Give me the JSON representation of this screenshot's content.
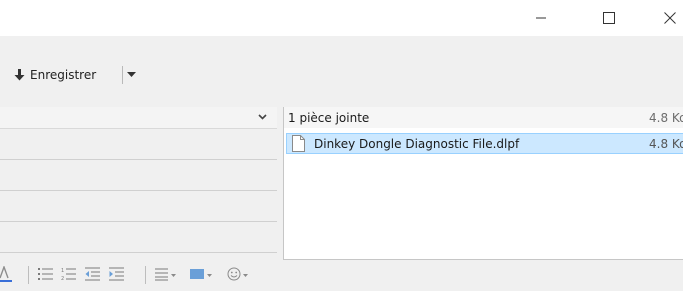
{
  "window_controls": {
    "minimize_icon": "minimize-icon",
    "maximize_icon": "maximize-icon",
    "close_icon": "close-icon"
  },
  "toolbar": {
    "save_label": "Enregistrer",
    "save_icon": "download-arrow-icon",
    "dropdown_icon": "caret-down-icon"
  },
  "attachments": {
    "header_label": "1 pièce jointe",
    "header_size": "4.8 Ko",
    "items": [
      {
        "name": "Dinkey Dongle Diagnostic File.dlpf",
        "size": "4.8 Ko"
      }
    ]
  },
  "colors": {
    "selection_fill": "#cce8ff",
    "selection_border": "#99d1ff",
    "icon_gray": "#7a7a7a"
  }
}
